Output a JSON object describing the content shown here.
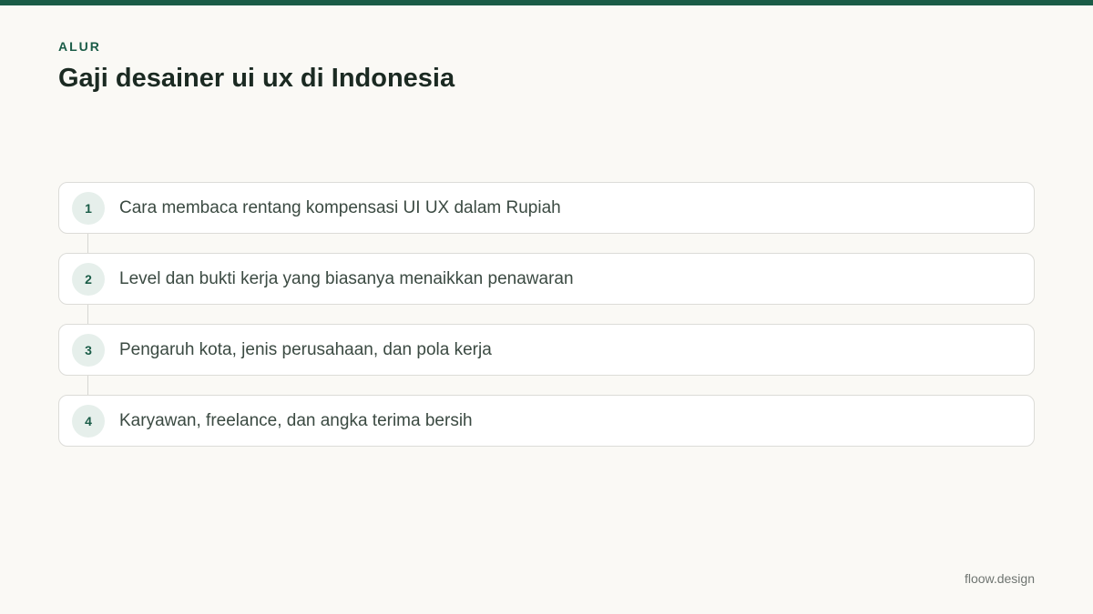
{
  "header": {
    "eyebrow": "ALUR",
    "title": "Gaji desainer ui ux di Indonesia"
  },
  "steps": [
    {
      "number": "1",
      "text": "Cara membaca rentang kompensasi UI UX dalam Rupiah"
    },
    {
      "number": "2",
      "text": "Level dan bukti kerja yang biasanya menaikkan penawaran"
    },
    {
      "number": "3",
      "text": "Pengaruh kota, jenis perusahaan, dan pola kerja"
    },
    {
      "number": "4",
      "text": "Karyawan, freelance, dan angka terima bersih"
    }
  ],
  "footer": {
    "brand": "floow.design"
  },
  "colors": {
    "accent": "#1a5c47",
    "background": "#faf9f5",
    "badge_bg": "#e6efeb",
    "title_text": "#1b2a22",
    "body_text": "#3b4a42"
  }
}
